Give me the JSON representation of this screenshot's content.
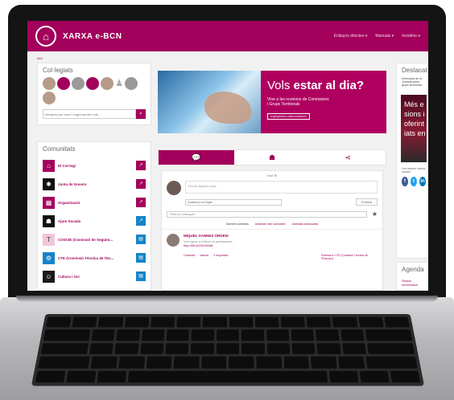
{
  "header": {
    "brand": "XARXA e-BCN",
    "nav": [
      "Enllaços directes ▾",
      "Manuals ▾",
      "Incidène ▾"
    ]
  },
  "breadcrumb": "Inici",
  "colegiats": {
    "title": "Col·legiats",
    "search_placeholder": "Introduïu per nom i cognoms del cole..."
  },
  "comunitats": {
    "title": "Comunitats",
    "items": [
      {
        "label": "El Col·legi",
        "icon": "⌂",
        "icon_color": "#a3005c",
        "btn": "mag"
      },
      {
        "label": "Junta de Govern",
        "icon": "✱",
        "icon_color": "#111111",
        "btn": "mag"
      },
      {
        "label": "Organització",
        "icon": "▦",
        "icon_color": "#a3005c",
        "btn": "mag"
      },
      {
        "label": "Ajuts Socials",
        "icon": "☗",
        "icon_color": "#111111",
        "btn": "blu"
      },
      {
        "label": "COSCIE (Comissió de Seguim...",
        "icon": "T",
        "icon_color": "#f3c5da",
        "btn": "blu"
      },
      {
        "label": "CTE (Comissió Tècnica de l'Ex...",
        "icon": "⚙",
        "icon_color": "#1583c9",
        "btn": "blu"
      },
      {
        "label": "Cultura i Oci",
        "icon": "☺",
        "icon_color": "#1a1a1a",
        "btn": "blu"
      }
    ]
  },
  "banner": {
    "title_light": "Vols ",
    "title_bold": "estar al dia?",
    "subtitle_1": "Vine a les reunions de Comissions",
    "subtitle_2": "i Grups Territorials",
    "url": "enginyersbcn.cat/comissions"
  },
  "feed": {
    "header": "Inici ⚙",
    "post_placeholder": "Escriu alguna cosa...",
    "select": "Qualsevol col·legiat",
    "post_button": "Publica",
    "filter_placeholder": "Filtra per continguts",
    "filter_tabs": [
      "Darreres activitats",
      "Activitats més valorades",
      "Activitats destacades"
    ],
    "entry": {
      "name": "MIQUEL SANNES ORDEIX",
      "text": "Vull agrair a tothom la participació...",
      "link": "http://bit.ly/2bG4Ha8",
      "actions": [
        "Comenta",
        "Valorar",
        "2 respostes"
      ],
      "right": "Publicat a CTE (Comissió Tècnica de l'Exercici)"
    }
  },
  "destacat": {
    "title": "Destacat",
    "text": "Informació de la Jornada sobre grups territorials",
    "video_lines": [
      "Més e",
      "sions i g",
      "oferint m",
      "iats en l"
    ],
    "share": "Les nostres xarxes socials"
  },
  "social": [
    {
      "name": "facebook-icon",
      "glyph": "f",
      "color": "#3b5998"
    },
    {
      "name": "twitter-icon",
      "glyph": "t",
      "color": "#1da1f2"
    },
    {
      "name": "linkedin-icon",
      "glyph": "in",
      "color": "#0077b5"
    }
  ],
  "agenda": {
    "title": "Agenda",
    "item": "Sessió Informativa"
  }
}
